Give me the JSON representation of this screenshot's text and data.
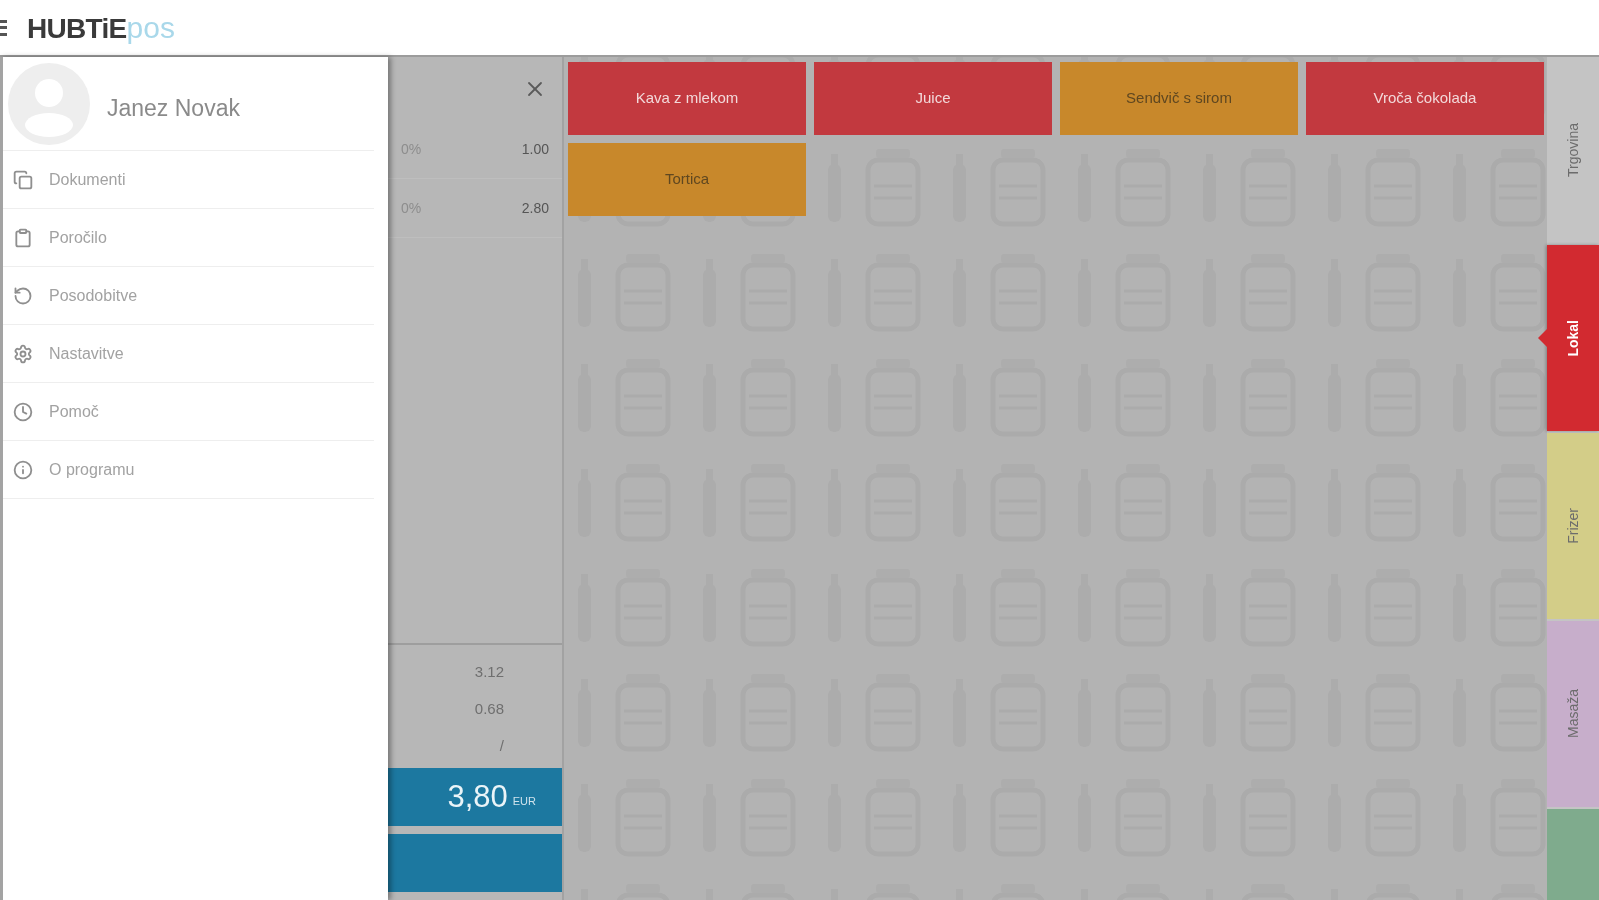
{
  "header": {
    "logo_main": "HUBTiE",
    "logo_suffix": "pos"
  },
  "sidebar": {
    "user_name": "Janez Novak",
    "items": [
      {
        "label": "Dokumenti"
      },
      {
        "label": "Poročilo"
      },
      {
        "label": "Posodobitve"
      },
      {
        "label": "Nastavitve"
      },
      {
        "label": "Pomoč"
      },
      {
        "label": "O programu"
      }
    ]
  },
  "order": {
    "lines": [
      {
        "tax": "0%",
        "amount": "1.00"
      },
      {
        "tax": "0%",
        "amount": "2.80"
      }
    ],
    "totals": [
      "3.12",
      "0.68",
      "/"
    ],
    "total_button": {
      "amount": "3,80",
      "currency": "EUR"
    }
  },
  "products": [
    {
      "label": "Kava z mlekom",
      "color": "#c2393f"
    },
    {
      "label": "Juice",
      "color": "#c2393f"
    },
    {
      "label": "Sendvič s sirom",
      "color": "#c8882b"
    },
    {
      "label": "Vroča čokolada",
      "color": "#c2393f"
    },
    {
      "label": "Tortica",
      "color": "#c8882b"
    }
  ],
  "category_tabs": [
    {
      "label": "Trgovina",
      "selected": false,
      "color": "#c4c4c4"
    },
    {
      "label": "Lokal",
      "selected": true,
      "color": "#d22a30"
    },
    {
      "label": "Frizer",
      "selected": false,
      "color": "#d3cd88"
    },
    {
      "label": "Masaža",
      "selected": false,
      "color": "#c7aecb"
    },
    {
      "selected": false,
      "color": "#7fab8d"
    }
  ]
}
